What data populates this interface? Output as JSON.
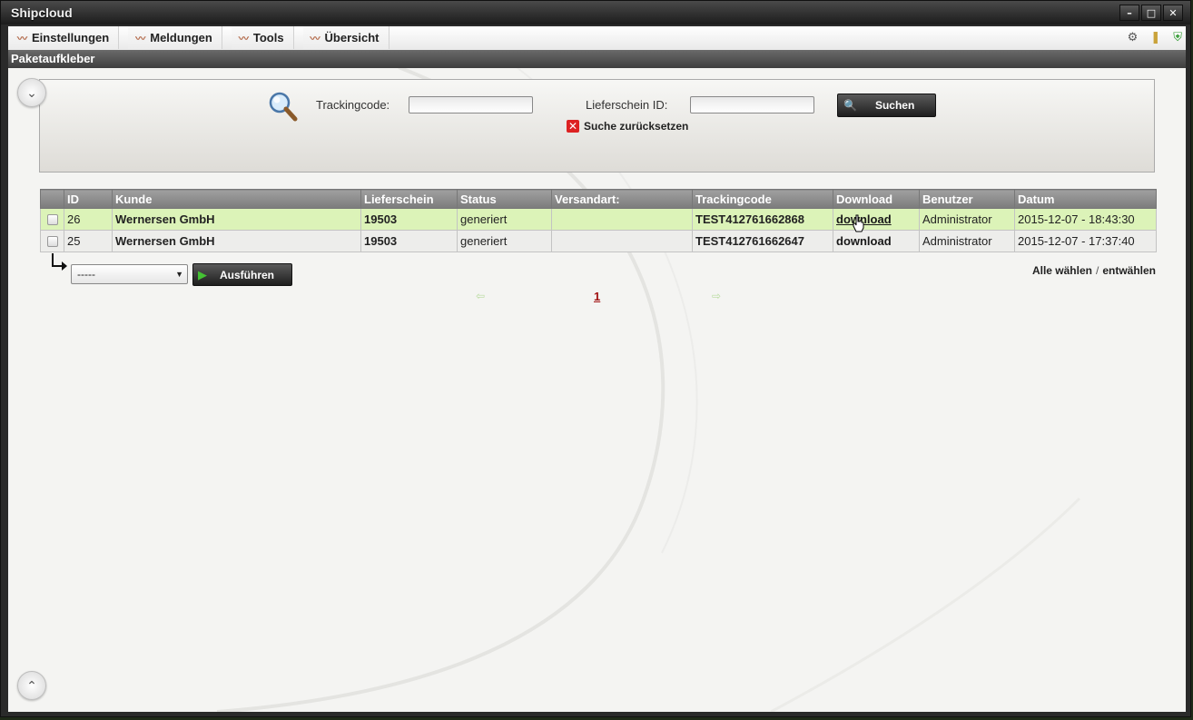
{
  "window": {
    "title": "Shipcloud",
    "minimize": "–",
    "maximize": "□",
    "close": "✕"
  },
  "menu": [
    {
      "label": "Einstellungen"
    },
    {
      "label": "Meldungen"
    },
    {
      "label": "Tools"
    },
    {
      "label": "Übersicht"
    }
  ],
  "menu_icon": "〰",
  "tray": {
    "icon1": "⚙",
    "icon2": "❚",
    "icon3": "⛨"
  },
  "section": {
    "title": "Paketaufkleber"
  },
  "search": {
    "tracking_label": "Trackingcode:",
    "tracking_value": "",
    "delivery_label": "Lieferschein ID:",
    "delivery_value": "",
    "button_label": "Suchen",
    "reset_label": "Suche zurücksetzen"
  },
  "table": {
    "columns": [
      "",
      "ID",
      "Kunde",
      "Lieferschein",
      "Status",
      "Versandart:",
      "Trackingcode",
      "Download",
      "Benutzer",
      "Datum"
    ],
    "rows": [
      {
        "id": "26",
        "kunde": "Wernersen GmbH",
        "lieferschein": "19503",
        "status": "generiert",
        "versandart": "",
        "tracking": "TEST412761662868",
        "download": "download",
        "benutzer": "Administrator",
        "datum": "2015-12-07 - 18:43:30"
      },
      {
        "id": "25",
        "kunde": "Wernersen GmbH",
        "lieferschein": "19503",
        "status": "generiert",
        "versandart": "",
        "tracking": "TEST412761662647",
        "download": "download",
        "benutzer": "Administrator",
        "datum": "2015-12-07 - 17:37:40"
      }
    ]
  },
  "bulk": {
    "select_value": "-----",
    "execute_label": "Ausführen"
  },
  "selection": {
    "all": "Alle wählen",
    "sep": "/",
    "none": "entwählen"
  },
  "pager": {
    "prev": "⇦",
    "page": "1",
    "next": "⇨"
  },
  "colors": {
    "highlight_row": "#dcf3b8",
    "link_red": "#8b1010",
    "header_gray": "#8a8a8a"
  }
}
